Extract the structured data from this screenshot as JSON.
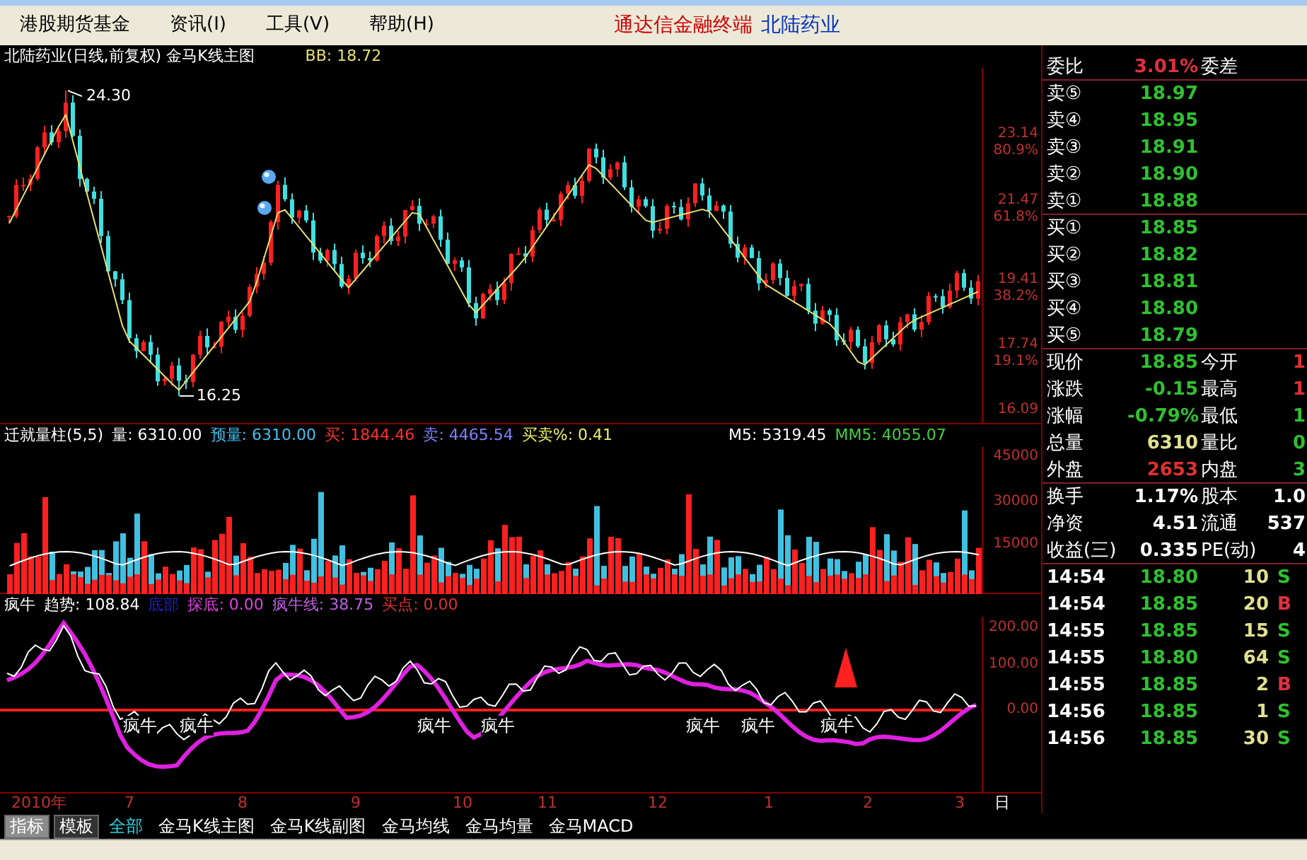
{
  "menu": {
    "items": [
      "港股期货基金",
      "资讯(I)",
      "工具(V)",
      "帮助(H)"
    ],
    "brand": "通达信金融终端",
    "stock": "北陆药业"
  },
  "main_chart": {
    "title": "北陆药业(日线,前复权) 金马K线主图",
    "readouts": [
      {
        "text": "BB: 18.72",
        "color": "#e8e070"
      }
    ],
    "high_label": "24.30",
    "low_label": "16.25",
    "axis": [
      "23.14",
      "80.9%",
      "21.47",
      "61.8%",
      "19.41",
      "38.2%",
      "17.74",
      "19.1%",
      "16.09"
    ]
  },
  "volume_chart": {
    "readouts": [
      {
        "text": "迁就量柱(5,5)",
        "color": "#ffffff"
      },
      {
        "text": "量: 6310.00",
        "color": "#ffffff"
      },
      {
        "text": "预量: 6310.00",
        "color": "#40c0f0"
      },
      {
        "text": "买: 1844.46",
        "color": "#ff3030"
      },
      {
        "text": "卖: 4465.54",
        "color": "#8080ff"
      },
      {
        "text": "买卖%: 0.41",
        "color": "#f0f060"
      }
    ],
    "readouts_right": [
      {
        "text": "M5: 5319.45",
        "color": "#ffffff"
      },
      {
        "text": "MM5: 4055.07",
        "color": "#40d040"
      }
    ],
    "axis": [
      "45000",
      "30000",
      "15000"
    ]
  },
  "indicator_chart": {
    "readouts": [
      {
        "text": "疯牛",
        "color": "#ffffff"
      },
      {
        "text": "趋势: 108.84",
        "color": "#ffffff"
      },
      {
        "text": "底部",
        "color": "#2020c0"
      },
      {
        "text": "探底: 0.00",
        "color": "#e040e0"
      },
      {
        "text": "疯牛线: 38.75",
        "color": "#c060e0"
      },
      {
        "text": "买点: 0.00",
        "color": "#e03030"
      }
    ],
    "axis": [
      "200.00",
      "100.00",
      "0.00"
    ],
    "signals": [
      "疯牛",
      "疯牛",
      "疯牛",
      "疯牛",
      "疯牛",
      "疯牛",
      "疯牛"
    ]
  },
  "date_axis": [
    "2010年",
    "7",
    "8",
    "9",
    "10",
    "11",
    "12",
    "1",
    "2",
    "3",
    "日"
  ],
  "quote": {
    "ratio": {
      "label": "委比",
      "value": "3.01%",
      "label2": "委差"
    },
    "asks": [
      {
        "label": "卖⑤",
        "price": "18.97"
      },
      {
        "label": "卖④",
        "price": "18.95"
      },
      {
        "label": "卖③",
        "price": "18.91"
      },
      {
        "label": "卖②",
        "price": "18.90"
      },
      {
        "label": "卖①",
        "price": "18.88"
      }
    ],
    "bids": [
      {
        "label": "买①",
        "price": "18.85"
      },
      {
        "label": "买②",
        "price": "18.82"
      },
      {
        "label": "买③",
        "price": "18.81"
      },
      {
        "label": "买④",
        "price": "18.80"
      },
      {
        "label": "买⑤",
        "price": "18.79"
      }
    ],
    "stats": [
      {
        "left": {
          "label": "现价",
          "value": "18.85",
          "color": "#30c030"
        },
        "right": {
          "label": "今开",
          "value": "1",
          "color": "#e03030"
        }
      },
      {
        "left": {
          "label": "涨跌",
          "value": "-0.15",
          "color": "#30c030"
        },
        "right": {
          "label": "最高",
          "value": "1",
          "color": "#e03030"
        }
      },
      {
        "left": {
          "label": "涨幅",
          "value": "-0.79%",
          "color": "#30c030"
        },
        "right": {
          "label": "最低",
          "value": "1",
          "color": "#30c030"
        }
      },
      {
        "left": {
          "label": "总量",
          "value": "6310",
          "color": "#e0e090"
        },
        "right": {
          "label": "量比",
          "value": "0",
          "color": "#30c030"
        }
      },
      {
        "left": {
          "label": "外盘",
          "value": "2653",
          "color": "#e03030"
        },
        "right": {
          "label": "内盘",
          "value": "3",
          "color": "#30c030"
        }
      }
    ],
    "fundamentals": [
      {
        "label": "换手",
        "value": "1.17%",
        "label2": "股本",
        "value2": "1.0"
      },
      {
        "label": "净资",
        "value": "4.51",
        "label2": "流通",
        "value2": "537"
      },
      {
        "label": "收益(三)",
        "value": "0.335",
        "label2": "PE(动)",
        "value2": "4"
      }
    ],
    "trades": [
      {
        "time": "14:54",
        "price": "18.80",
        "volume": "10",
        "side": "S"
      },
      {
        "time": "14:54",
        "price": "18.85",
        "volume": "20",
        "side": "B"
      },
      {
        "time": "14:55",
        "price": "18.85",
        "volume": "15",
        "side": "S"
      },
      {
        "time": "14:55",
        "price": "18.80",
        "volume": "64",
        "side": "S"
      },
      {
        "time": "14:55",
        "price": "18.85",
        "volume": "2",
        "side": "B"
      },
      {
        "time": "14:56",
        "price": "18.85",
        "volume": "1",
        "side": "S"
      },
      {
        "time": "14:56",
        "price": "18.85",
        "volume": "30",
        "side": "S"
      }
    ]
  },
  "bottom_tabs": {
    "buttons": [
      {
        "label": "指标",
        "selected": true
      },
      {
        "label": "模板",
        "selected": false
      }
    ],
    "tabs": [
      {
        "label": "全部",
        "selected": true
      },
      {
        "label": "金马K线主图",
        "selected": false
      },
      {
        "label": "金马K线副图",
        "selected": false
      },
      {
        "label": "金马均线",
        "selected": false
      },
      {
        "label": "金马均量",
        "selected": false
      },
      {
        "label": "金马MACD",
        "selected": false
      }
    ]
  }
}
